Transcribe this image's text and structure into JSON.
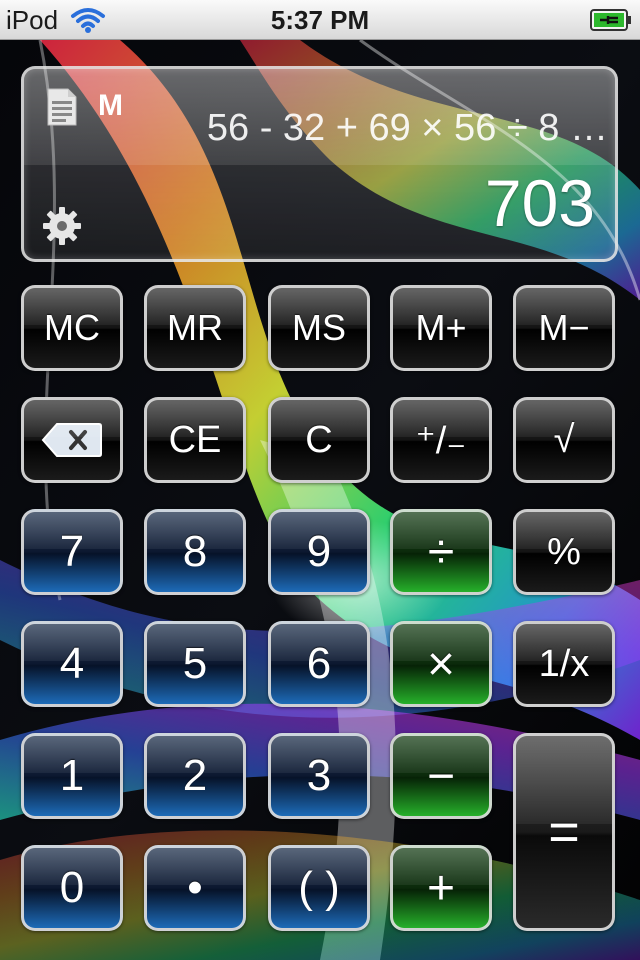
{
  "status_bar": {
    "carrier": "iPod",
    "time": "5:37 PM"
  },
  "display": {
    "memory_indicator": "M",
    "expression": "56 - 32 + 69 × 56 ÷ 8 …",
    "result": "703"
  },
  "keys": {
    "mc": "MC",
    "mr": "MR",
    "ms": "MS",
    "m_plus": "M+",
    "m_minus": "M−",
    "ce": "CE",
    "c": "C",
    "plus_minus": "⁺/₋",
    "sqrt": "√",
    "seven": "7",
    "eight": "8",
    "nine": "9",
    "divide": "÷",
    "percent": "%",
    "four": "4",
    "five": "5",
    "six": "6",
    "multiply": "×",
    "reciprocal": "1/x",
    "one": "1",
    "two": "2",
    "three": "3",
    "subtract": "−",
    "equals": "=",
    "zero": "0",
    "decimal": "•",
    "parens": "( )",
    "add": "+"
  },
  "colors": {
    "number_key": "#1d6bb8",
    "operator_key": "#26b02a",
    "function_key": "#1b1b1b",
    "battery_charging": "#2db82d"
  },
  "icons": {
    "wifi": "wifi-icon",
    "battery": "battery-charging-icon",
    "history": "document-icon",
    "settings": "gear-icon",
    "backspace": "backspace-icon"
  }
}
